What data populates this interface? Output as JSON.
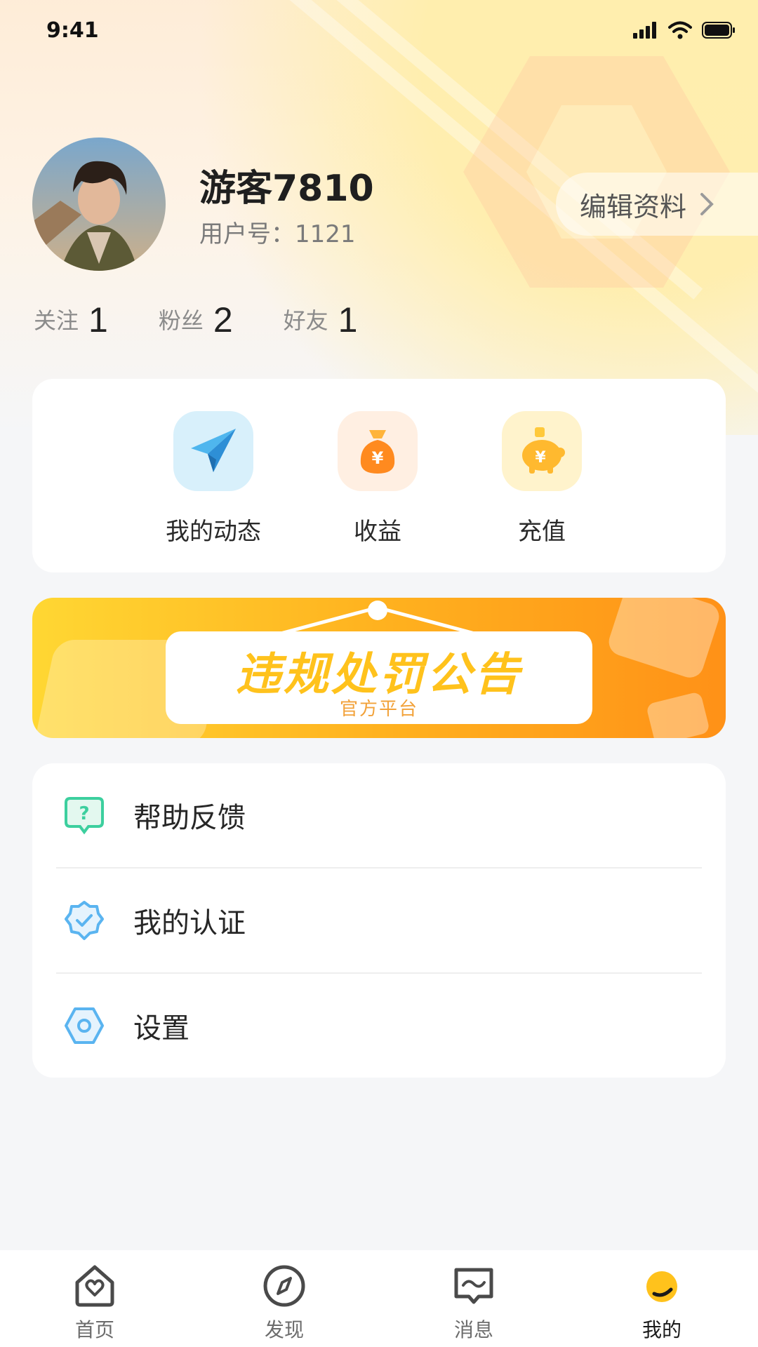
{
  "status_bar": {
    "time": "9:41"
  },
  "profile": {
    "username": "游客7810",
    "user_id_label": "用户号：",
    "user_id": "1121",
    "edit_label": "编辑资料"
  },
  "stats": [
    {
      "label": "关注",
      "value": "1"
    },
    {
      "label": "粉丝",
      "value": "2"
    },
    {
      "label": "好友",
      "value": "1"
    }
  ],
  "quick_actions": [
    {
      "label": "我的动态",
      "icon": "paper-plane-icon"
    },
    {
      "label": "收益",
      "icon": "money-bag-icon"
    },
    {
      "label": "充值",
      "icon": "piggy-bank-icon"
    }
  ],
  "banner": {
    "title": "违规处罚公告",
    "subtitle": "官方平台"
  },
  "menu": [
    {
      "label": "帮助反馈",
      "icon": "help-bubble-icon",
      "color": "#3ccf9e"
    },
    {
      "label": "我的认证",
      "icon": "verified-badge-icon",
      "color": "#5ab4f0"
    },
    {
      "label": "设置",
      "icon": "settings-hexagon-icon",
      "color": "#5ab4f0"
    }
  ],
  "bottom_nav": [
    {
      "label": "首页",
      "icon": "home-heart-icon"
    },
    {
      "label": "发现",
      "icon": "compass-icon"
    },
    {
      "label": "消息",
      "icon": "message-icon"
    },
    {
      "label": "我的",
      "icon": "profile-dot-icon",
      "active": true
    }
  ],
  "colors": {
    "accent": "#ffb21f",
    "banner_title": "#ffc21c",
    "text_primary": "#1f1f1f",
    "text_secondary": "#7a7a7a"
  }
}
